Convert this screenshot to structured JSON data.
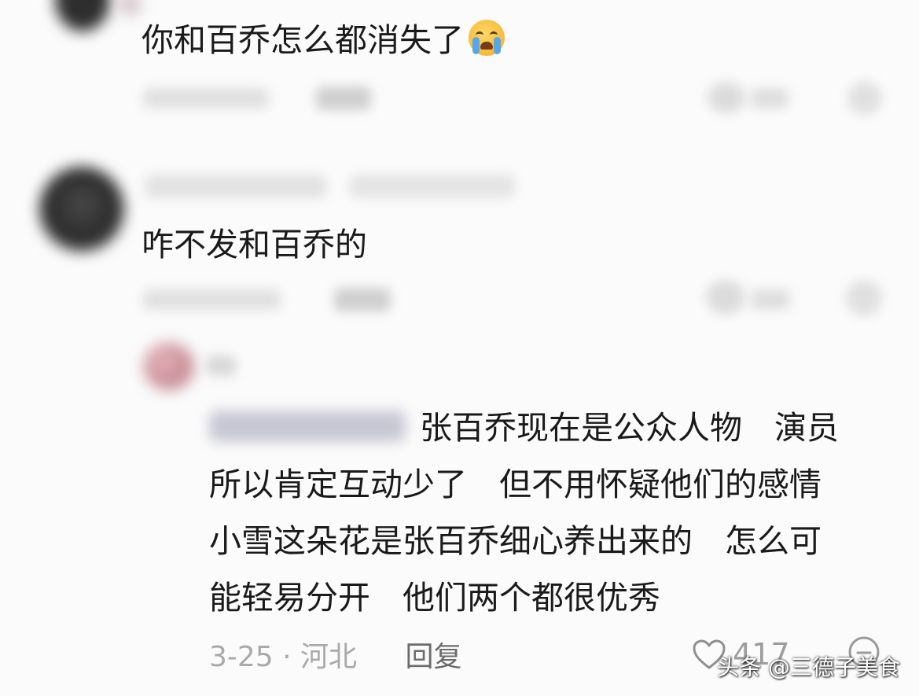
{
  "comments": [
    {
      "text": "你和百乔怎么都消失了",
      "emoji": "loudly-crying-face"
    },
    {
      "text": "咋不发和百乔的"
    }
  ],
  "reply": {
    "lines": [
      "张百乔现在是公众人物　演员",
      "所以肯定互动少了　但不用怀疑他们的感情",
      "小雪这朵花是张百乔细心养出来的　怎么可",
      "能轻易分开　他们两个都很优秀"
    ],
    "date_location": "3-25 · 河北",
    "reply_label": "回复",
    "like_count": "417"
  },
  "watermark": "头条 @三德子美食",
  "colors": {
    "background": "#fbfbfb",
    "text": "#1a1a1a",
    "meta": "#a9a9a9"
  }
}
